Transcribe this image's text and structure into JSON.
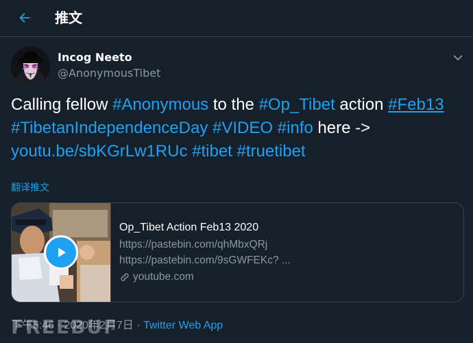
{
  "header": {
    "title": "推文"
  },
  "author": {
    "name": "Incog Neeto",
    "handle": "@AnonymousTibet"
  },
  "tweet": {
    "segments": [
      {
        "text": "Calling fellow ",
        "type": "plain"
      },
      {
        "text": "#Anonymous",
        "type": "hashtag"
      },
      {
        "text": " to the ",
        "type": "plain"
      },
      {
        "text": "#Op_Tibet",
        "type": "hashtag"
      },
      {
        "text": " action ",
        "type": "plain"
      },
      {
        "text": "#Feb13",
        "type": "hashtag-underlined"
      },
      {
        "text": " ",
        "type": "plain"
      },
      {
        "text": "#TibetanIndependenceDay",
        "type": "hashtag"
      },
      {
        "text": " ",
        "type": "plain"
      },
      {
        "text": "#VIDEO",
        "type": "hashtag"
      },
      {
        "text": " ",
        "type": "plain"
      },
      {
        "text": "#info",
        "type": "hashtag"
      },
      {
        "text": " here -> ",
        "type": "plain"
      },
      {
        "text": "youtu.be/sbKGrLw1RUc",
        "type": "link"
      },
      {
        "text": " ",
        "type": "plain"
      },
      {
        "text": "#tibet",
        "type": "hashtag"
      },
      {
        "text": " ",
        "type": "plain"
      },
      {
        "text": "#truetibet",
        "type": "hashtag"
      }
    ],
    "translate_label": "翻译推文"
  },
  "card": {
    "title": "Op_Tibet Action Feb13 2020",
    "line1": "https://pastebin.com/qhMbxQRj",
    "line2": "https://pastebin.com/9sGWFEKc? ...",
    "domain": "youtube.com"
  },
  "meta": {
    "time_date": "下午5:46 · 2020年2月7日",
    "separator": " · ",
    "app": "Twitter Web App"
  },
  "watermark": {
    "text": "FREEBUF"
  },
  "colors": {
    "background": "#15202b",
    "accent": "#1da1f2",
    "secondary_text": "#8899a6",
    "border": "#38444d"
  },
  "icons": {
    "back": "arrow-left-icon",
    "more": "chevron-down-icon",
    "play": "play-icon",
    "link": "link-icon"
  }
}
